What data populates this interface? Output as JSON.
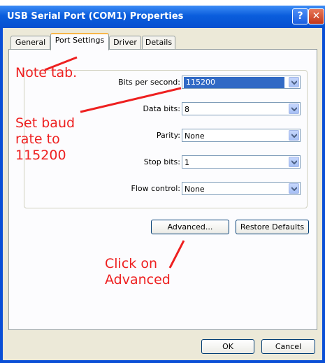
{
  "window": {
    "title": "USB Serial Port (COM1) Properties",
    "help_glyph": "?",
    "close_glyph": "✕"
  },
  "tabs": [
    {
      "label": "General"
    },
    {
      "label": "Port Settings",
      "active": true
    },
    {
      "label": "Driver"
    },
    {
      "label": "Details"
    }
  ],
  "settings": {
    "bits_per_second": {
      "label": "Bits per second:",
      "value": "115200"
    },
    "data_bits": {
      "label": "Data bits:",
      "value": "8"
    },
    "parity": {
      "label": "Parity:",
      "value": "None"
    },
    "stop_bits": {
      "label": "Stop bits:",
      "value": "1"
    },
    "flow_control": {
      "label": "Flow control:",
      "value": "None"
    }
  },
  "buttons": {
    "advanced": "Advanced...",
    "restore_defaults": "Restore Defaults",
    "ok": "OK",
    "cancel": "Cancel"
  },
  "annotations": {
    "note_tab": "Note tab.",
    "set_baud": "Set baud\nrate to\n115200",
    "click_advanced": "Click on\nAdvanced",
    "color": "#ee2020"
  }
}
